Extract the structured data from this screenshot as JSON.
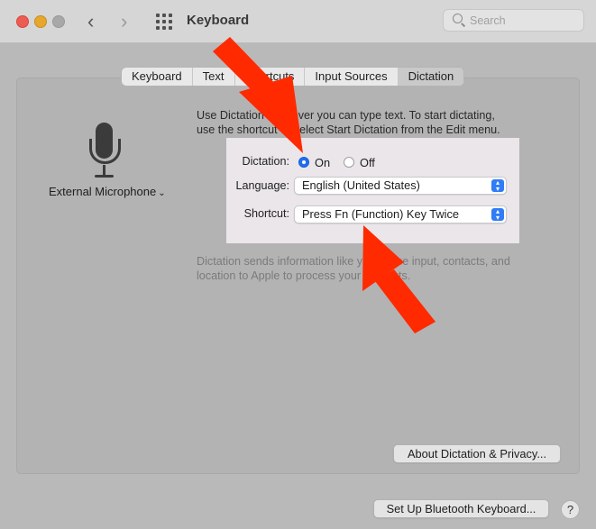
{
  "window": {
    "title": "Keyboard",
    "back_glyph": "‹",
    "forward_glyph": "›"
  },
  "search": {
    "placeholder": "Search",
    "value": ""
  },
  "tabs": [
    {
      "label": "Keyboard",
      "selected": false
    },
    {
      "label": "Text",
      "selected": false
    },
    {
      "label": "Shortcuts",
      "selected": false
    },
    {
      "label": "Input Sources",
      "selected": false
    },
    {
      "label": "Dictation",
      "selected": true
    }
  ],
  "microphone": {
    "label": "External Microphone",
    "chevron": "⌄",
    "icon": "microphone-icon"
  },
  "intro": {
    "line1": "Use Dictation wherever you can type text. To start dictating,",
    "line2": "use the shortcut or select Start Dictation from the Edit menu."
  },
  "dictation": {
    "label": "Dictation:",
    "on_label": "On",
    "off_label": "Off",
    "value": "On"
  },
  "language": {
    "label": "Language:",
    "value": "English (United States)"
  },
  "shortcut": {
    "label": "Shortcut:",
    "value": "Press Fn (Function) Key Twice"
  },
  "privacy_text": {
    "line1": "Dictation sends information like your voice input, contacts, and",
    "line2": "location to Apple to process your requests."
  },
  "buttons": {
    "about": "About Dictation & Privacy...",
    "bluetooth": "Set Up Bluetooth Keyboard...",
    "help": "?"
  },
  "colors": {
    "accent": "#1e6ff1",
    "annotation_arrow": "#ff2a00",
    "highlight_box": "#eae6ea"
  }
}
